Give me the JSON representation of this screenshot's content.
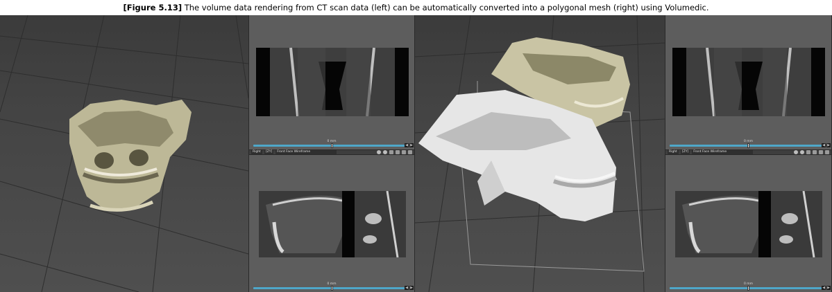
{
  "caption": {
    "figure_label": "[Figure 5.13]",
    "text": "The volume data rendering from CT scan data (left) can be automatically converted into a polygonal mesh (right) using Volumedic."
  },
  "left_group": {
    "top_slider": {
      "label": "0 mm",
      "position": 0.5
    },
    "toolbar": {
      "view": "Right",
      "dropdown": "[ZY]",
      "shading": "Front Face Wireframe"
    },
    "bottom_slider": {
      "label": "0 mm",
      "position": 0.5
    }
  },
  "right_group": {
    "top_slider": {
      "label": "0 mm",
      "position": 0.5
    },
    "toolbar": {
      "view": "Right",
      "dropdown": "[ZY]",
      "shading": "Front Face Wireframe"
    },
    "bottom_slider": {
      "label": "0 mm",
      "position": 0.5
    }
  },
  "colors": {
    "bone_rendered": "#c9c4a4",
    "mesh_white": "#e6e6e6",
    "slider_accent": "#4ea7c9",
    "viewport_bg": "#444444"
  },
  "icons": [
    "move-icon",
    "rotate-icon",
    "zoom-icon",
    "maximize-icon",
    "render-icon",
    "camera-icon"
  ]
}
